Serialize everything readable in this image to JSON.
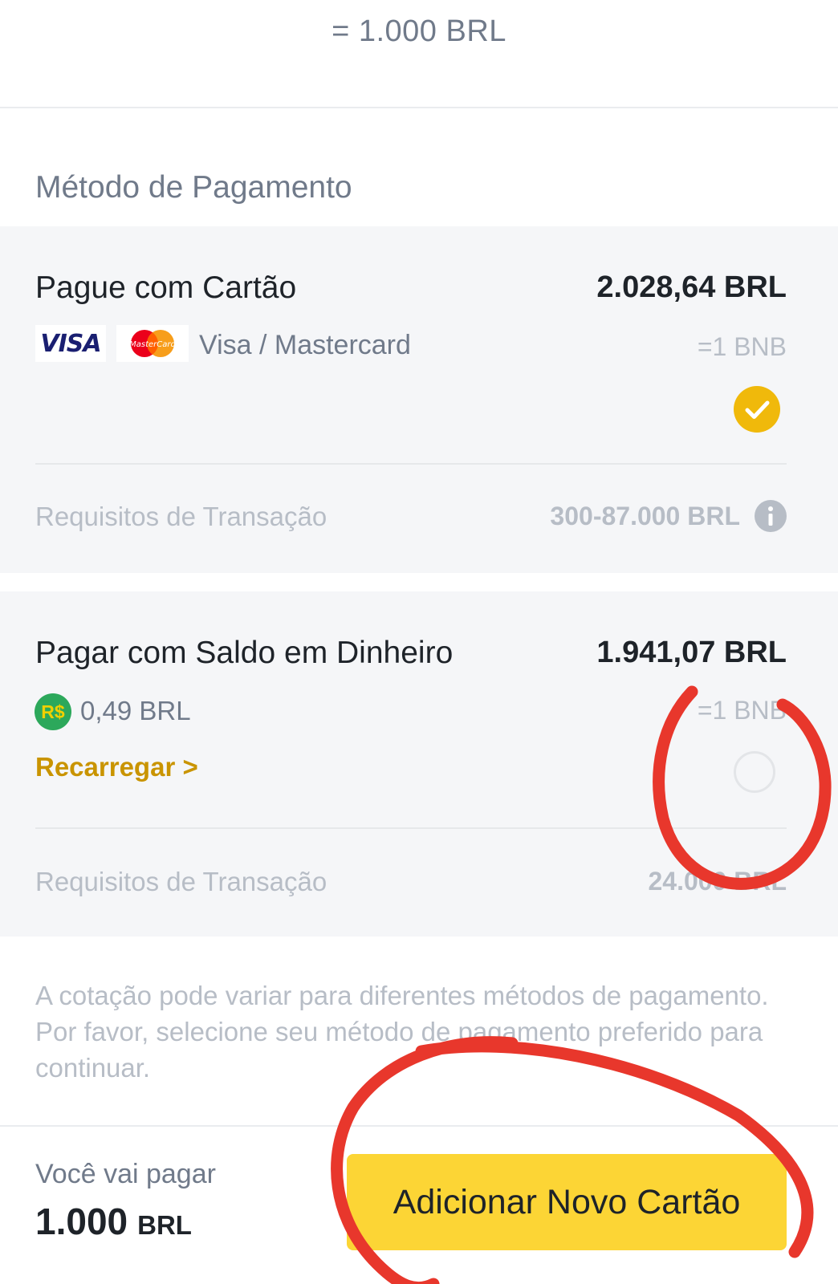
{
  "header": {
    "conversion": "= 1.000 BRL"
  },
  "section": {
    "title": "Método de Pagamento"
  },
  "card_option": {
    "title": "Pague com Cartão",
    "amount": "2.028,64 BRL",
    "visa_logo": "VISA",
    "mastercard_logo": "MasterCard",
    "brands": "Visa / Mastercard",
    "rate": "=1 BNB",
    "selected": true,
    "requirements_label": "Requisitos de Transação",
    "requirements_value": "300-87.000 BRL",
    "icons": {
      "selected": "check-circle-icon",
      "info": "info-icon"
    }
  },
  "cash_option": {
    "title": "Pagar com Saldo em Dinheiro",
    "amount": "1.941,07 BRL",
    "currency_badge": "R$",
    "balance": "0,49 BRL",
    "rate": "=1 BNB",
    "recharge": "Recarregar >",
    "selected": false,
    "requirements_label": "Requisitos de Transação",
    "requirements_value": "24.000 BRL",
    "icons": {
      "radio": "radio-empty-icon",
      "currency": "brl-coin-icon"
    }
  },
  "notice": "A cotação pode variar para diferentes métodos de pagamento. Por favor, selecione seu método de pagamento preferido para continuar.",
  "footer": {
    "pay_label": "Você vai pagar",
    "pay_amount": "1.000",
    "pay_currency": "BRL",
    "button": "Adicionar Novo Cartão"
  },
  "colors": {
    "accent_yellow": "#fcd535",
    "check_yellow": "#f0b90b",
    "link_gold": "#c99400",
    "annotation_red": "#e8372c",
    "card_bg": "#f5f6f8",
    "muted_text": "#b7bdc6",
    "secondary_text": "#707a8a"
  }
}
